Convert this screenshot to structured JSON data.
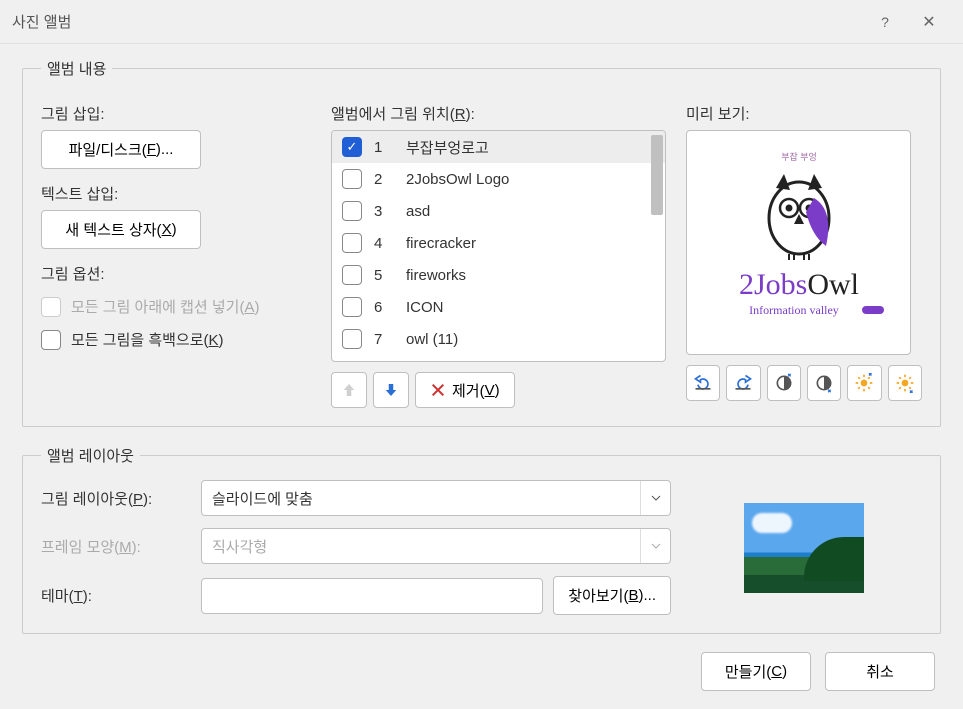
{
  "window": {
    "title": "사진 앨범",
    "help_icon": "?",
    "close_icon": "✕"
  },
  "album_content": {
    "legend": "앨범 내용",
    "insert_picture_label": "그림 삽입:",
    "file_disk_button_pre": "파일/디스크(",
    "file_disk_button_key": "F",
    "file_disk_button_post": ")...",
    "insert_text_label": "텍스트 삽입:",
    "new_textbox_button_pre": "새 텍스트 상자(",
    "new_textbox_button_key": "X",
    "new_textbox_button_post": ")",
    "picture_options_label": "그림 옵션:",
    "caption_checkbox_pre": "모든 그림 아래에 캡션 넣기(",
    "caption_checkbox_key": "A",
    "caption_checkbox_post": ")",
    "bw_checkbox_pre": "모든 그림을 흑백으로(",
    "bw_checkbox_key": "K",
    "bw_checkbox_post": ")",
    "position_label_pre": "앨범에서 그림 위치(",
    "position_label_key": "R",
    "position_label_post": "):",
    "items": [
      {
        "num": "1",
        "name": "부잡부엉로고",
        "checked": true
      },
      {
        "num": "2",
        "name": "2JobsOwl Logo",
        "checked": false
      },
      {
        "num": "3",
        "name": "asd",
        "checked": false
      },
      {
        "num": "4",
        "name": "firecracker",
        "checked": false
      },
      {
        "num": "5",
        "name": "fireworks",
        "checked": false
      },
      {
        "num": "6",
        "name": "ICON",
        "checked": false
      },
      {
        "num": "7",
        "name": "owl (11)",
        "checked": false
      }
    ],
    "remove_button_pre": "제거(",
    "remove_button_key": "V",
    "remove_button_post": ")",
    "preview_label": "미리 보기:",
    "preview_logo": {
      "small_text": "부잡 부엉",
      "brand_pre": "2",
      "brand_mid": "Jobs",
      "brand_post": "Owl",
      "tagline": "Information valley"
    }
  },
  "album_layout": {
    "legend": "앨범 레이아웃",
    "picture_layout_label_pre": "그림 레이아웃(",
    "picture_layout_label_key": "P",
    "picture_layout_label_post": "):",
    "picture_layout_value": "슬라이드에 맞춤",
    "frame_shape_label_pre": "프레임 모양(",
    "frame_shape_label_key": "M",
    "frame_shape_label_post": "):",
    "frame_shape_value": "직사각형",
    "theme_label_pre": "테마(",
    "theme_label_key": "T",
    "theme_label_post": "):",
    "theme_value": "",
    "browse_button_pre": "찾아보기(",
    "browse_button_key": "B",
    "browse_button_post": ")..."
  },
  "footer": {
    "create_button_pre": "만들기(",
    "create_button_key": "C",
    "create_button_post": ")",
    "cancel_button": "취소"
  }
}
